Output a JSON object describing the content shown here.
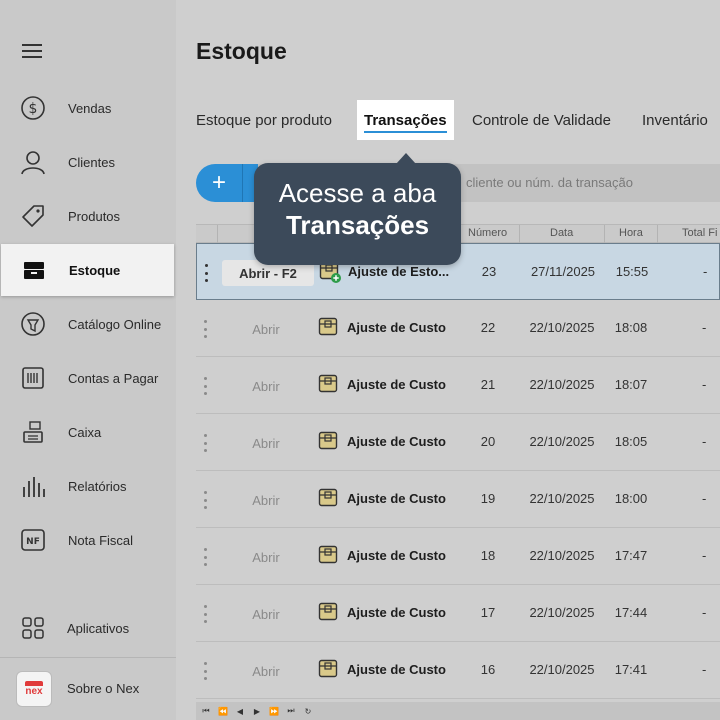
{
  "sidebar": {
    "items": [
      {
        "label": "Vendas",
        "icon": "dollar-circle-icon"
      },
      {
        "label": "Clientes",
        "icon": "user-icon"
      },
      {
        "label": "Produtos",
        "icon": "tag-icon"
      },
      {
        "label": "Estoque",
        "icon": "box-icon",
        "active": true
      },
      {
        "label": "Catálogo Online",
        "icon": "catalog-icon"
      },
      {
        "label": "Contas a Pagar",
        "icon": "bill-icon"
      },
      {
        "label": "Caixa",
        "icon": "cash-register-icon"
      },
      {
        "label": "Relatórios",
        "icon": "bar-chart-icon"
      },
      {
        "label": "Nota Fiscal",
        "icon": "nf-icon"
      },
      {
        "label": "Aplicativos",
        "icon": "apps-grid-icon"
      },
      {
        "label": "Sobre o Nex",
        "icon": "nex-logo"
      }
    ],
    "logo_text": "nex"
  },
  "main": {
    "title": "Estoque",
    "tabs": [
      {
        "label": "Estoque por produto"
      },
      {
        "label": "Transações",
        "active": true
      },
      {
        "label": "Controle de Validade"
      },
      {
        "label": "Inventário"
      }
    ],
    "add_label": "+",
    "search_placeholder": "cliente ou núm. da transação",
    "columns": {
      "numero": "Número",
      "data": "Data",
      "hora": "Hora",
      "total": "Total Fi"
    },
    "rows": [
      {
        "open": "Abrir - F2",
        "desc": "Ajuste de Esto...",
        "num": "23",
        "date": "27/11/2025",
        "time": "15:55",
        "total": "-",
        "selected": true
      },
      {
        "open": "Abrir",
        "desc": "Ajuste de Custo",
        "num": "22",
        "date": "22/10/2025",
        "time": "18:08",
        "total": "-"
      },
      {
        "open": "Abrir",
        "desc": "Ajuste de Custo",
        "num": "21",
        "date": "22/10/2025",
        "time": "18:07",
        "total": "-"
      },
      {
        "open": "Abrir",
        "desc": "Ajuste de Custo",
        "num": "20",
        "date": "22/10/2025",
        "time": "18:05",
        "total": "-"
      },
      {
        "open": "Abrir",
        "desc": "Ajuste de Custo",
        "num": "19",
        "date": "22/10/2025",
        "time": "18:00",
        "total": "-"
      },
      {
        "open": "Abrir",
        "desc": "Ajuste de Custo",
        "num": "18",
        "date": "22/10/2025",
        "time": "17:47",
        "total": "-"
      },
      {
        "open": "Abrir",
        "desc": "Ajuste de Custo",
        "num": "17",
        "date": "22/10/2025",
        "time": "17:44",
        "total": "-"
      },
      {
        "open": "Abrir",
        "desc": "Ajuste de Custo",
        "num": "16",
        "date": "22/10/2025",
        "time": "17:41",
        "total": "-"
      }
    ],
    "pager": [
      "⏮",
      "⏪",
      "◀",
      "▶",
      "⏩",
      "⏭",
      "↻"
    ]
  },
  "tooltip": {
    "line1": "Acesse a aba",
    "line2": "Transações"
  },
  "colors": {
    "accent": "#2b8fd6",
    "tooltip_bg": "#3c4a5a",
    "selected_row": "#c8d7e3"
  }
}
